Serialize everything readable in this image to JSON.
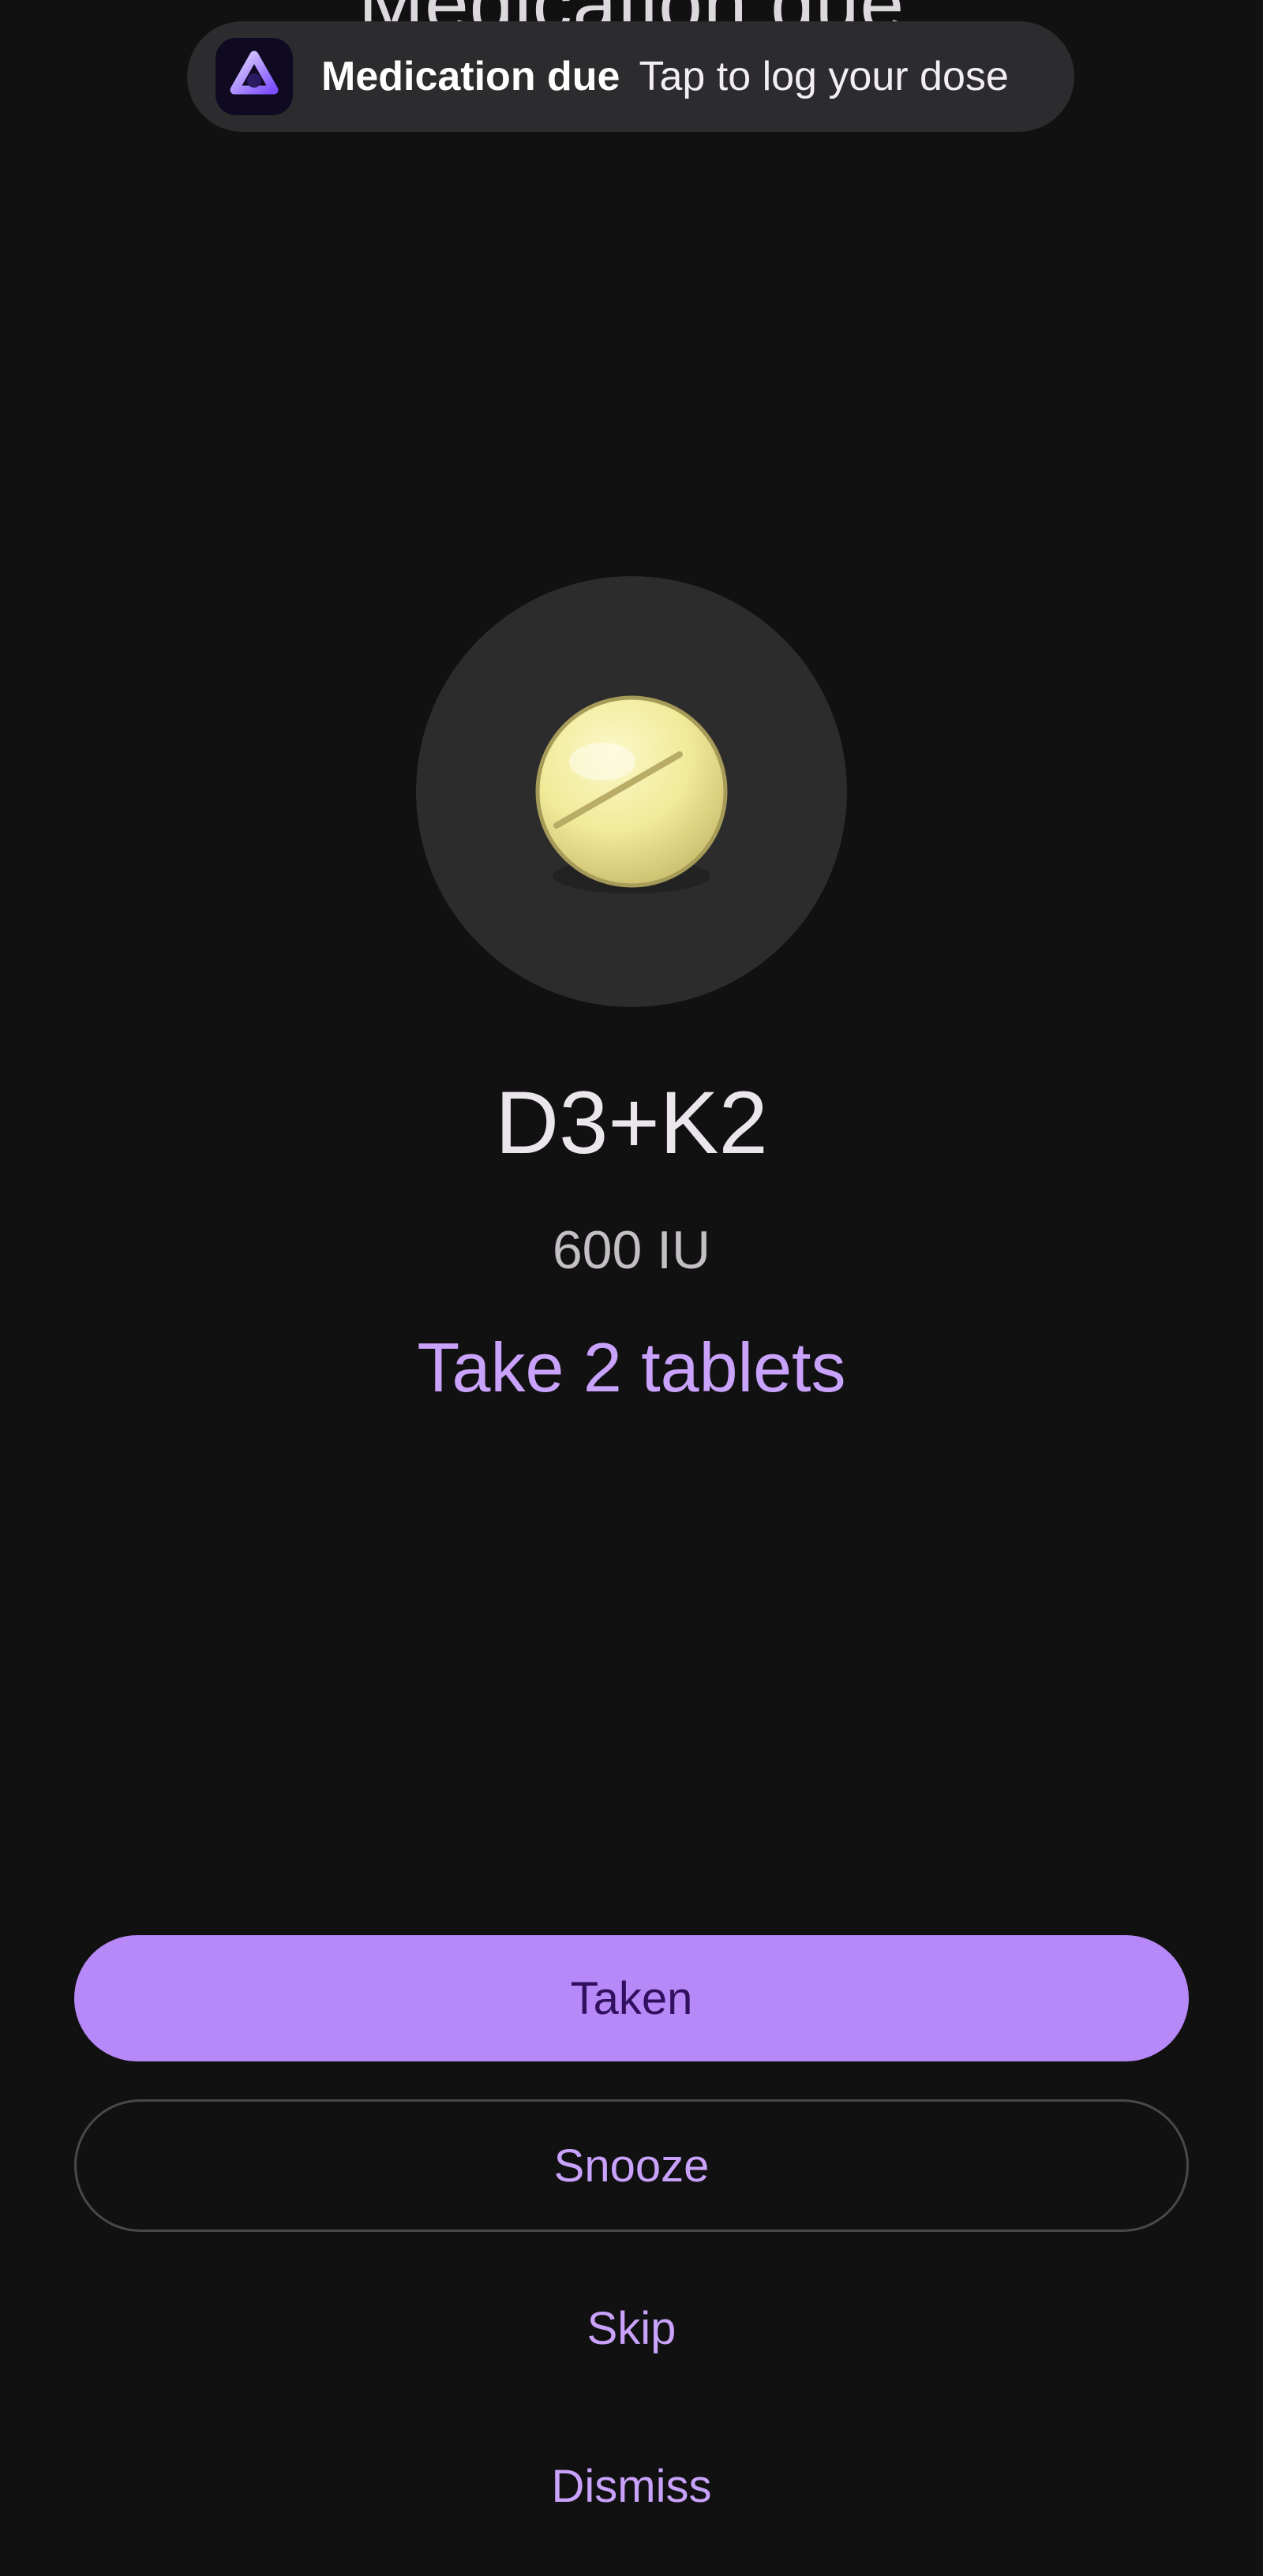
{
  "screen": {
    "background_title": "Medication due"
  },
  "notification": {
    "app_icon": "app-logo-icon",
    "title": "Medication due",
    "body": "Tap to log your dose"
  },
  "medication": {
    "icon": "pill-icon",
    "name": "D3+K2",
    "dose": "600 IU",
    "instruction": "Take 2 tablets"
  },
  "actions": {
    "taken_label": "Taken",
    "snooze_label": "Snooze",
    "skip_label": "Skip",
    "dismiss_label": "Dismiss"
  },
  "colors": {
    "background": "#121112",
    "accent": "#b788f7",
    "accent_text": "#c9a2fb",
    "on_accent": "#31115f",
    "pill": "#f1ec9c"
  }
}
